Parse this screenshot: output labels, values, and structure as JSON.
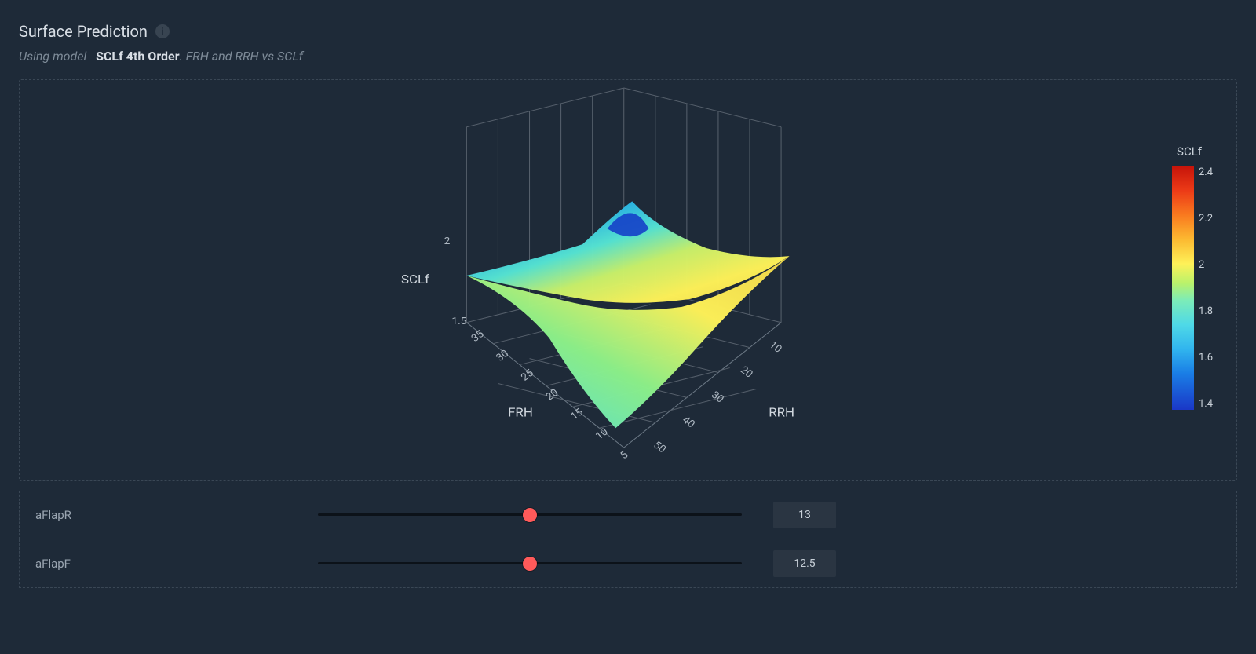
{
  "header": {
    "title": "Surface Prediction",
    "subtitle_prefix": "Using model",
    "model_name": "SCLf 4th Order",
    "subtitle_suffix": ". FRH and RRH vs SCLf"
  },
  "chart_data": {
    "type": "surface3d",
    "title": "",
    "x_axis": {
      "label": "FRH",
      "ticks": [
        5,
        10,
        15,
        20,
        25,
        30,
        35
      ],
      "range": [
        5,
        35
      ],
      "reversed": true
    },
    "y_axis": {
      "label": "RRH",
      "ticks": [
        10,
        20,
        30,
        40,
        50
      ],
      "range": [
        10,
        50
      ],
      "reversed": true
    },
    "z_axis": {
      "label": "SCLf",
      "ticks": [
        1.5,
        2
      ],
      "range": [
        1.4,
        2.5
      ]
    },
    "colorbar": {
      "label": "SCLf",
      "ticks": [
        1.4,
        1.6,
        1.8,
        2,
        2.2,
        2.4
      ],
      "range": [
        1.4,
        2.4
      ]
    },
    "surface_description": "4th-order polynomial fit of SCLf over FRH × RRH; saddle-shaped, peak near low-FRH/mid-RRH, colored by SCLf value"
  },
  "sliders": [
    {
      "name": "aFlapR",
      "label": "aFlapR",
      "value": 13,
      "min": 0,
      "max": 26,
      "thumb_pct": 50
    },
    {
      "name": "aFlapF",
      "label": "aFlapF",
      "value": 12.5,
      "min": 0,
      "max": 25,
      "thumb_pct": 50
    }
  ],
  "colors": {
    "background": "#1e2a38",
    "accent": "#ff5a5a"
  }
}
